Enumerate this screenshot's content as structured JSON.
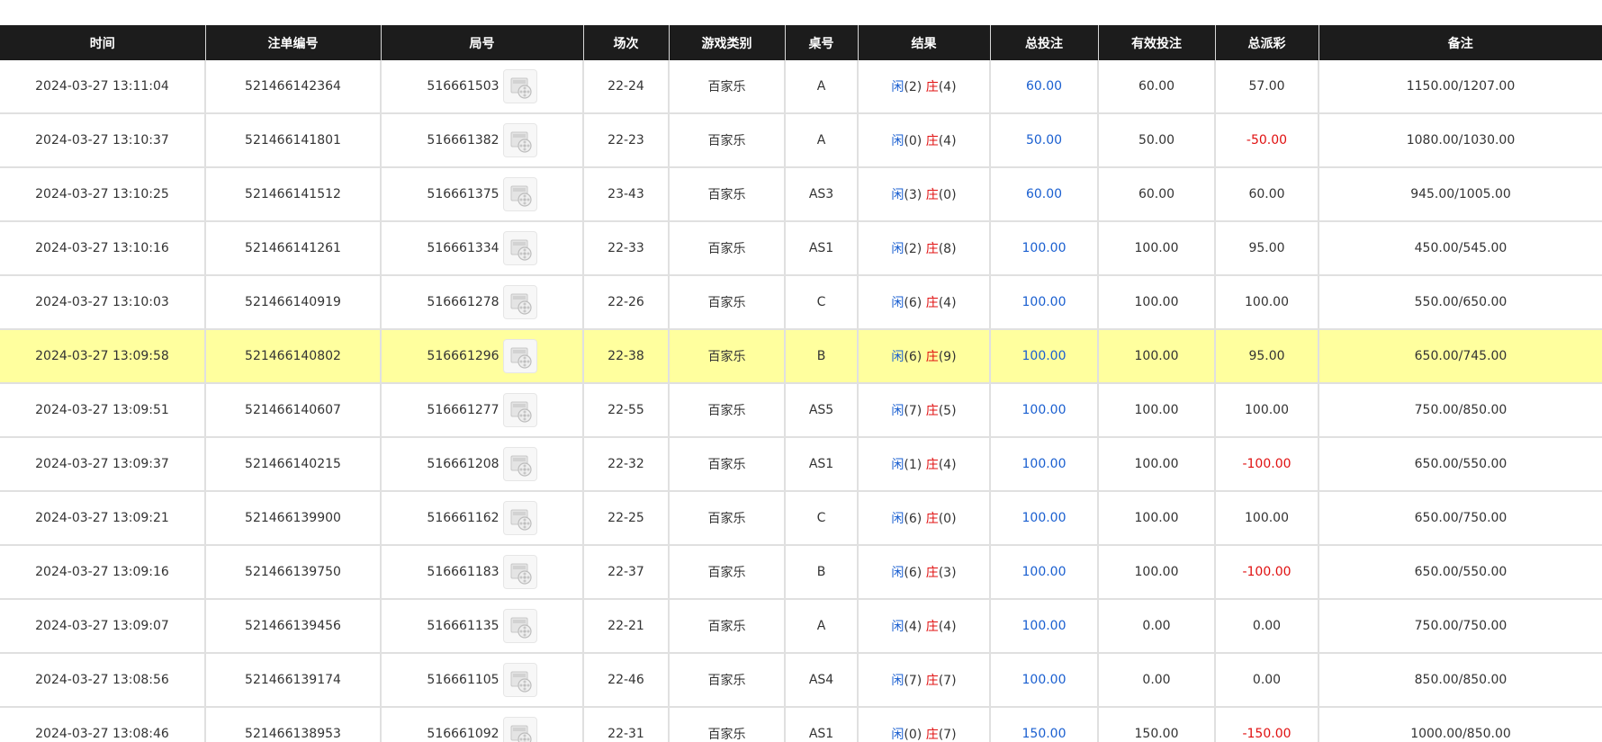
{
  "columns": [
    "时间",
    "注单编号",
    "局号",
    "场次",
    "游戏类别",
    "桌号",
    "结果",
    "总投注",
    "有效投注",
    "总派彩",
    "备注"
  ],
  "result_labels": {
    "player": "闲",
    "banker": "庄"
  },
  "colors": {
    "header_bg": "#1c1c1c",
    "blue": "#1a5fd0",
    "red": "#e01010",
    "highlight": "#ffff9e"
  },
  "rows": [
    {
      "time": "2024-03-27 13:11:04",
      "bet_id": "521466142364",
      "round_id": "516661503",
      "shoe": "22-24",
      "game": "百家乐",
      "table": "A",
      "player_score": "(2)",
      "banker_score": "(4)",
      "total_bet": "60.00",
      "valid_bet": "60.00",
      "payout": "57.00",
      "payout_negative": false,
      "note": "1150.00/1207.00",
      "highlight": false
    },
    {
      "time": "2024-03-27 13:10:37",
      "bet_id": "521466141801",
      "round_id": "516661382",
      "shoe": "22-23",
      "game": "百家乐",
      "table": "A",
      "player_score": "(0)",
      "banker_score": "(4)",
      "total_bet": "50.00",
      "valid_bet": "50.00",
      "payout": "-50.00",
      "payout_negative": true,
      "note": "1080.00/1030.00",
      "highlight": false
    },
    {
      "time": "2024-03-27 13:10:25",
      "bet_id": "521466141512",
      "round_id": "516661375",
      "shoe": "23-43",
      "game": "百家乐",
      "table": "AS3",
      "player_score": "(3)",
      "banker_score": "(0)",
      "total_bet": "60.00",
      "valid_bet": "60.00",
      "payout": "60.00",
      "payout_negative": false,
      "note": "945.00/1005.00",
      "highlight": false
    },
    {
      "time": "2024-03-27 13:10:16",
      "bet_id": "521466141261",
      "round_id": "516661334",
      "shoe": "22-33",
      "game": "百家乐",
      "table": "AS1",
      "player_score": "(2)",
      "banker_score": "(8)",
      "total_bet": "100.00",
      "valid_bet": "100.00",
      "payout": "95.00",
      "payout_negative": false,
      "note": "450.00/545.00",
      "highlight": false
    },
    {
      "time": "2024-03-27 13:10:03",
      "bet_id": "521466140919",
      "round_id": "516661278",
      "shoe": "22-26",
      "game": "百家乐",
      "table": "C",
      "player_score": "(6)",
      "banker_score": "(4)",
      "total_bet": "100.00",
      "valid_bet": "100.00",
      "payout": "100.00",
      "payout_negative": false,
      "note": "550.00/650.00",
      "highlight": false
    },
    {
      "time": "2024-03-27 13:09:58",
      "bet_id": "521466140802",
      "round_id": "516661296",
      "shoe": "22-38",
      "game": "百家乐",
      "table": "B",
      "player_score": "(6)",
      "banker_score": "(9)",
      "total_bet": "100.00",
      "valid_bet": "100.00",
      "payout": "95.00",
      "payout_negative": false,
      "note": "650.00/745.00",
      "highlight": true
    },
    {
      "time": "2024-03-27 13:09:51",
      "bet_id": "521466140607",
      "round_id": "516661277",
      "shoe": "22-55",
      "game": "百家乐",
      "table": "AS5",
      "player_score": "(7)",
      "banker_score": "(5)",
      "total_bet": "100.00",
      "valid_bet": "100.00",
      "payout": "100.00",
      "payout_negative": false,
      "note": "750.00/850.00",
      "highlight": false
    },
    {
      "time": "2024-03-27 13:09:37",
      "bet_id": "521466140215",
      "round_id": "516661208",
      "shoe": "22-32",
      "game": "百家乐",
      "table": "AS1",
      "player_score": "(1)",
      "banker_score": "(4)",
      "total_bet": "100.00",
      "valid_bet": "100.00",
      "payout": "-100.00",
      "payout_negative": true,
      "note": "650.00/550.00",
      "highlight": false
    },
    {
      "time": "2024-03-27 13:09:21",
      "bet_id": "521466139900",
      "round_id": "516661162",
      "shoe": "22-25",
      "game": "百家乐",
      "table": "C",
      "player_score": "(6)",
      "banker_score": "(0)",
      "total_bet": "100.00",
      "valid_bet": "100.00",
      "payout": "100.00",
      "payout_negative": false,
      "note": "650.00/750.00",
      "highlight": false
    },
    {
      "time": "2024-03-27 13:09:16",
      "bet_id": "521466139750",
      "round_id": "516661183",
      "shoe": "22-37",
      "game": "百家乐",
      "table": "B",
      "player_score": "(6)",
      "banker_score": "(3)",
      "total_bet": "100.00",
      "valid_bet": "100.00",
      "payout": "-100.00",
      "payout_negative": true,
      "note": "650.00/550.00",
      "highlight": false
    },
    {
      "time": "2024-03-27 13:09:07",
      "bet_id": "521466139456",
      "round_id": "516661135",
      "shoe": "22-21",
      "game": "百家乐",
      "table": "A",
      "player_score": "(4)",
      "banker_score": "(4)",
      "total_bet": "100.00",
      "valid_bet": "0.00",
      "payout": "0.00",
      "payout_negative": false,
      "note": "750.00/750.00",
      "highlight": false
    },
    {
      "time": "2024-03-27 13:08:56",
      "bet_id": "521466139174",
      "round_id": "516661105",
      "shoe": "22-46",
      "game": "百家乐",
      "table": "AS4",
      "player_score": "(7)",
      "banker_score": "(7)",
      "total_bet": "100.00",
      "valid_bet": "0.00",
      "payout": "0.00",
      "payout_negative": false,
      "note": "850.00/850.00",
      "highlight": false
    },
    {
      "time": "2024-03-27 13:08:46",
      "bet_id": "521466138953",
      "round_id": "516661092",
      "shoe": "22-31",
      "game": "百家乐",
      "table": "AS1",
      "player_score": "(0)",
      "banker_score": "(7)",
      "total_bet": "150.00",
      "valid_bet": "150.00",
      "payout": "-150.00",
      "payout_negative": true,
      "note": "1000.00/850.00",
      "highlight": false
    }
  ]
}
